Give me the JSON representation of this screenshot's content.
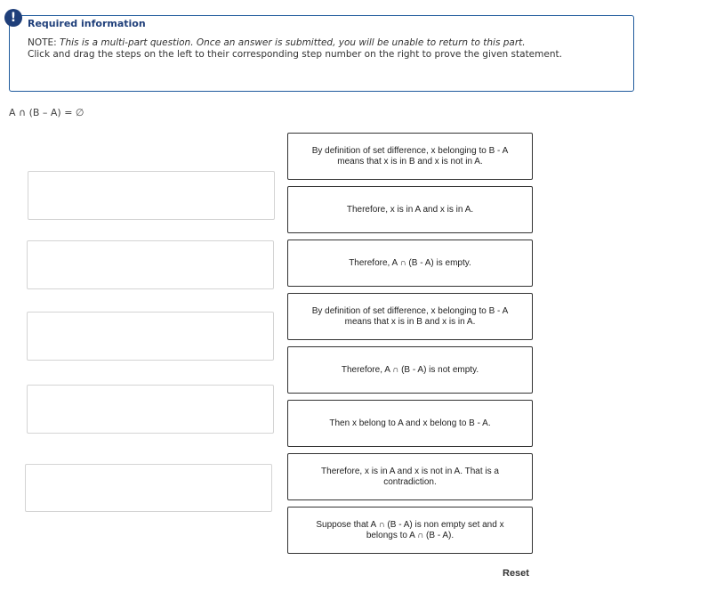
{
  "header": {
    "icon": "!",
    "title": "Required information",
    "note_label": "NOTE: ",
    "note_text": "This is a multi-part question. Once an answer is submitted, you will be unable to return to this part.",
    "instructions": "Click and drag the steps on the left to their corresponding step number on the right to prove the given statement."
  },
  "statement": "A ∩ (B – A) = ∅",
  "steps": [
    "By definition of set difference, x belonging to B - A means that x is in B and x is not in A.",
    "Therefore, x is in A and x is in A.",
    "Therefore, A ∩ (B - A) is empty.",
    "By definition of set difference, x belonging to B - A means that x is in B and x is in A.",
    "Therefore, A ∩ (B - A) is not empty.",
    "Then x belong to A and x belong to B - A.",
    "Therefore, x is in A and x is not in A. That is a contradiction.",
    "Suppose that A ∩ (B - A) is non empty set and x belongs to A ∩ (B - A)."
  ],
  "reset_label": "Reset"
}
